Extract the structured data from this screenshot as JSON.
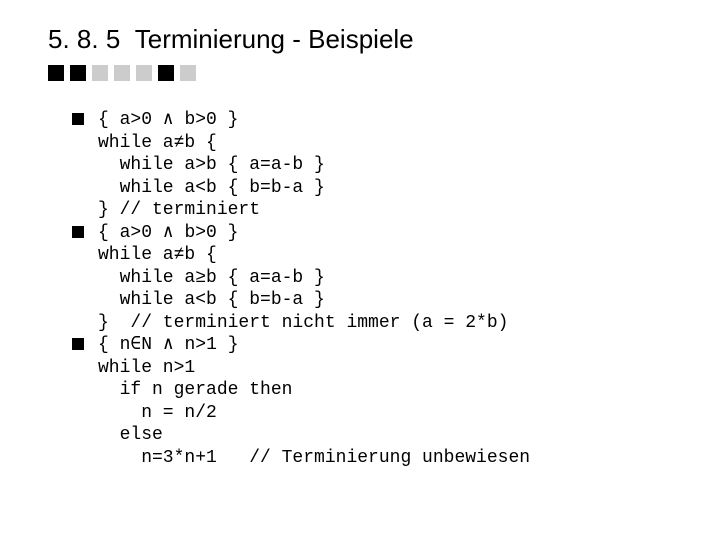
{
  "header": {
    "section_number": "5. 8. 5",
    "title": "Terminierung - Beispiele"
  },
  "decor": {
    "pattern": [
      "dark",
      "dark",
      "light",
      "light",
      "light",
      "dark",
      "light"
    ]
  },
  "items": [
    {
      "lines": [
        "{ a>0 ∧ b>0 }",
        "while a≠b {",
        "  while a>b { a=a-b }",
        "  while a<b { b=b-a }",
        "} // terminiert"
      ]
    },
    {
      "lines": [
        "{ a>0 ∧ b>0 }",
        "while a≠b {",
        "  while a≥b { a=a-b }",
        "  while a<b { b=b-a }",
        "}  // terminiert nicht immer (a = 2*b)"
      ]
    },
    {
      "lines": [
        "{ n∈N ∧ n>1 }",
        "while n>1",
        "  if n gerade then",
        "    n = n/2",
        "  else",
        "    n=3*n+1   // Terminierung unbewiesen"
      ]
    }
  ]
}
